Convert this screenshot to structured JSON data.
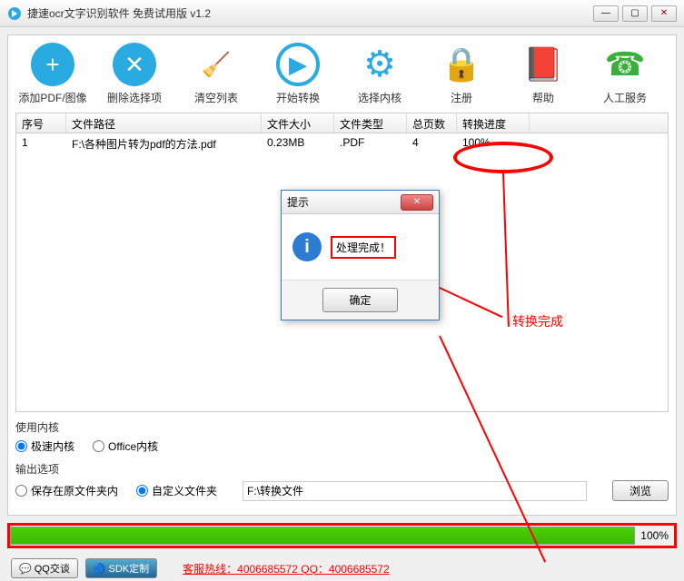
{
  "titlebar": {
    "title": "捷速ocr文字识别软件 免费试用版 v1.2"
  },
  "toolbar": [
    {
      "label": "添加PDF/图像",
      "icon": "+",
      "color": "#29abe2"
    },
    {
      "label": "删除选择项",
      "icon": "✕",
      "color": "#29abe2"
    },
    {
      "label": "清空列表",
      "icon": "🧹",
      "color": "transparent"
    },
    {
      "label": "开始转换",
      "icon": "▶",
      "color": "#29abe2"
    },
    {
      "label": "选择内核",
      "icon": "⚙",
      "color": "transparent"
    },
    {
      "label": "注册",
      "icon": "🔒",
      "color": "transparent"
    },
    {
      "label": "帮助",
      "icon": "?",
      "color": "transparent"
    },
    {
      "label": "人工服务",
      "icon": "☎",
      "color": "transparent"
    }
  ],
  "table": {
    "headers": {
      "seq": "序号",
      "path": "文件路径",
      "size": "文件大小",
      "type": "文件类型",
      "pages": "总页数",
      "progress": "转换进度"
    },
    "rows": [
      {
        "seq": "1",
        "path": "F:\\各种图片转为pdf的方法.pdf",
        "size": "0.23MB",
        "type": ".PDF",
        "pages": "4",
        "progress": "100%"
      }
    ]
  },
  "kernel": {
    "label": "使用内核",
    "options": {
      "fast": "极速内核",
      "office": "Office内核"
    }
  },
  "output": {
    "label": "输出选项",
    "options": {
      "original": "保存在原文件夹内",
      "custom": "自定义文件夹"
    },
    "path": "F:\\转换文件",
    "browse": "浏览"
  },
  "progress": {
    "text": "100%"
  },
  "footer": {
    "qq": "QQ交谈",
    "sdk": "SDK定制",
    "hotline": "客服热线：4006685572 QQ：4006685572"
  },
  "dialog": {
    "title": "提示",
    "message": "处理完成！",
    "ok": "确定"
  },
  "annotation": {
    "text": "转换完成"
  }
}
